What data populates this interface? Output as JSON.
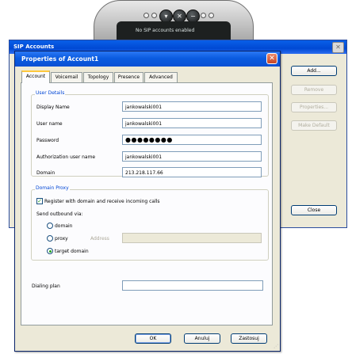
{
  "phone": {
    "screen_text": "No SIP accounts enabled",
    "knob_icons": [
      "▾",
      "✕",
      "−"
    ]
  },
  "sip_window": {
    "title": "SIP Accounts",
    "close_glyph": "✕",
    "buttons": {
      "add": "Add...",
      "remove": "Remove",
      "properties": "Properties...",
      "make_default": "Make Default",
      "close": "Close"
    }
  },
  "dialog": {
    "title": "Properties of Account1",
    "close_glyph": "✕",
    "tabs": [
      "Account",
      "Voicemail",
      "Topology",
      "Presence",
      "Advanced"
    ],
    "active_tab": "Account",
    "user_details": {
      "group_label": "User Details",
      "fields": [
        {
          "label": "Display Name",
          "value": "jankowalski001"
        },
        {
          "label": "User name",
          "value": "jankowalski001"
        },
        {
          "label": "Password",
          "value": "●●●●●●●●"
        },
        {
          "label": "Authorization user name",
          "value": "jankowalski001"
        },
        {
          "label": "Domain",
          "value": "213.218.117.66"
        }
      ]
    },
    "domain_proxy": {
      "group_label": "Domain Proxy",
      "register_label": "Register with domain and receive incoming calls",
      "register_checked": true,
      "send_outbound_label": "Send outbound via:",
      "options": [
        "domain",
        "proxy",
        "target domain"
      ],
      "selected_option": "target domain",
      "address_label": "Address",
      "address_value": ""
    },
    "dialing_plan": {
      "label": "Dialing plan",
      "value": ""
    },
    "buttons": {
      "ok": "OK",
      "cancel": "Anuluj",
      "apply": "Zastosuj"
    }
  }
}
